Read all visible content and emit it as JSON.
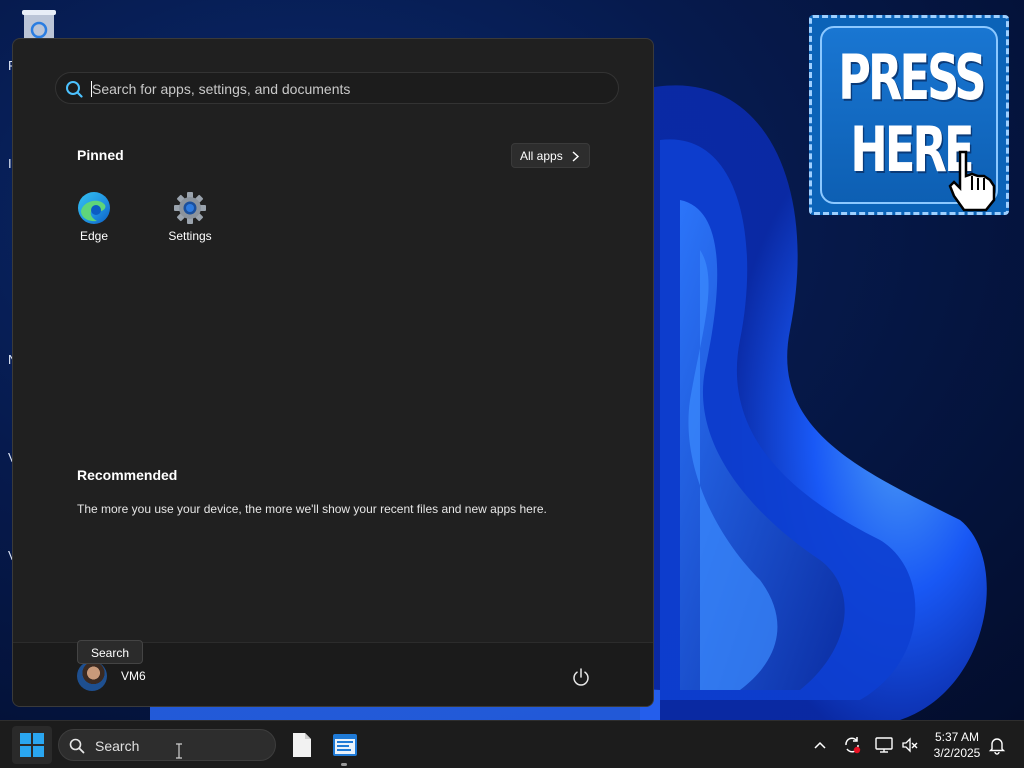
{
  "desktop": {
    "edge_letters": [
      "F",
      "I",
      "N",
      "V",
      "V"
    ],
    "ad": {
      "text_line1": "PRESS",
      "text_line2": "HERE",
      "colors": {
        "background": "#0b63b8",
        "border": "#9fd0ff"
      }
    }
  },
  "start_menu": {
    "search_placeholder": "Search for apps, settings, and documents",
    "pinned_heading": "Pinned",
    "all_apps_label": "All apps",
    "pinned_apps": [
      {
        "label": "Edge",
        "icon": "edge-icon"
      },
      {
        "label": "Settings",
        "icon": "gear-icon"
      }
    ],
    "recommended_heading": "Recommended",
    "recommended_text": "The more you use your device, the more we'll show your recent files and new apps here.",
    "user_name": "VM6",
    "power_icon": "power-icon",
    "tooltip": "Search"
  },
  "taskbar": {
    "search_label": "Search",
    "apps": [
      {
        "name": "file-explorer",
        "icon": "document-icon"
      },
      {
        "name": "notepad-app",
        "icon": "app-window-icon",
        "active": true
      }
    ],
    "tray": {
      "icons": [
        "chevron-up-icon",
        "sync-icon",
        "network-icon",
        "volume-muted-icon"
      ],
      "time": "5:37 AM",
      "date": "3/2/2025",
      "notification_icon": "bell-icon"
    },
    "colors": {
      "background": "#1c1c1c",
      "accent": "#0078d4"
    }
  }
}
